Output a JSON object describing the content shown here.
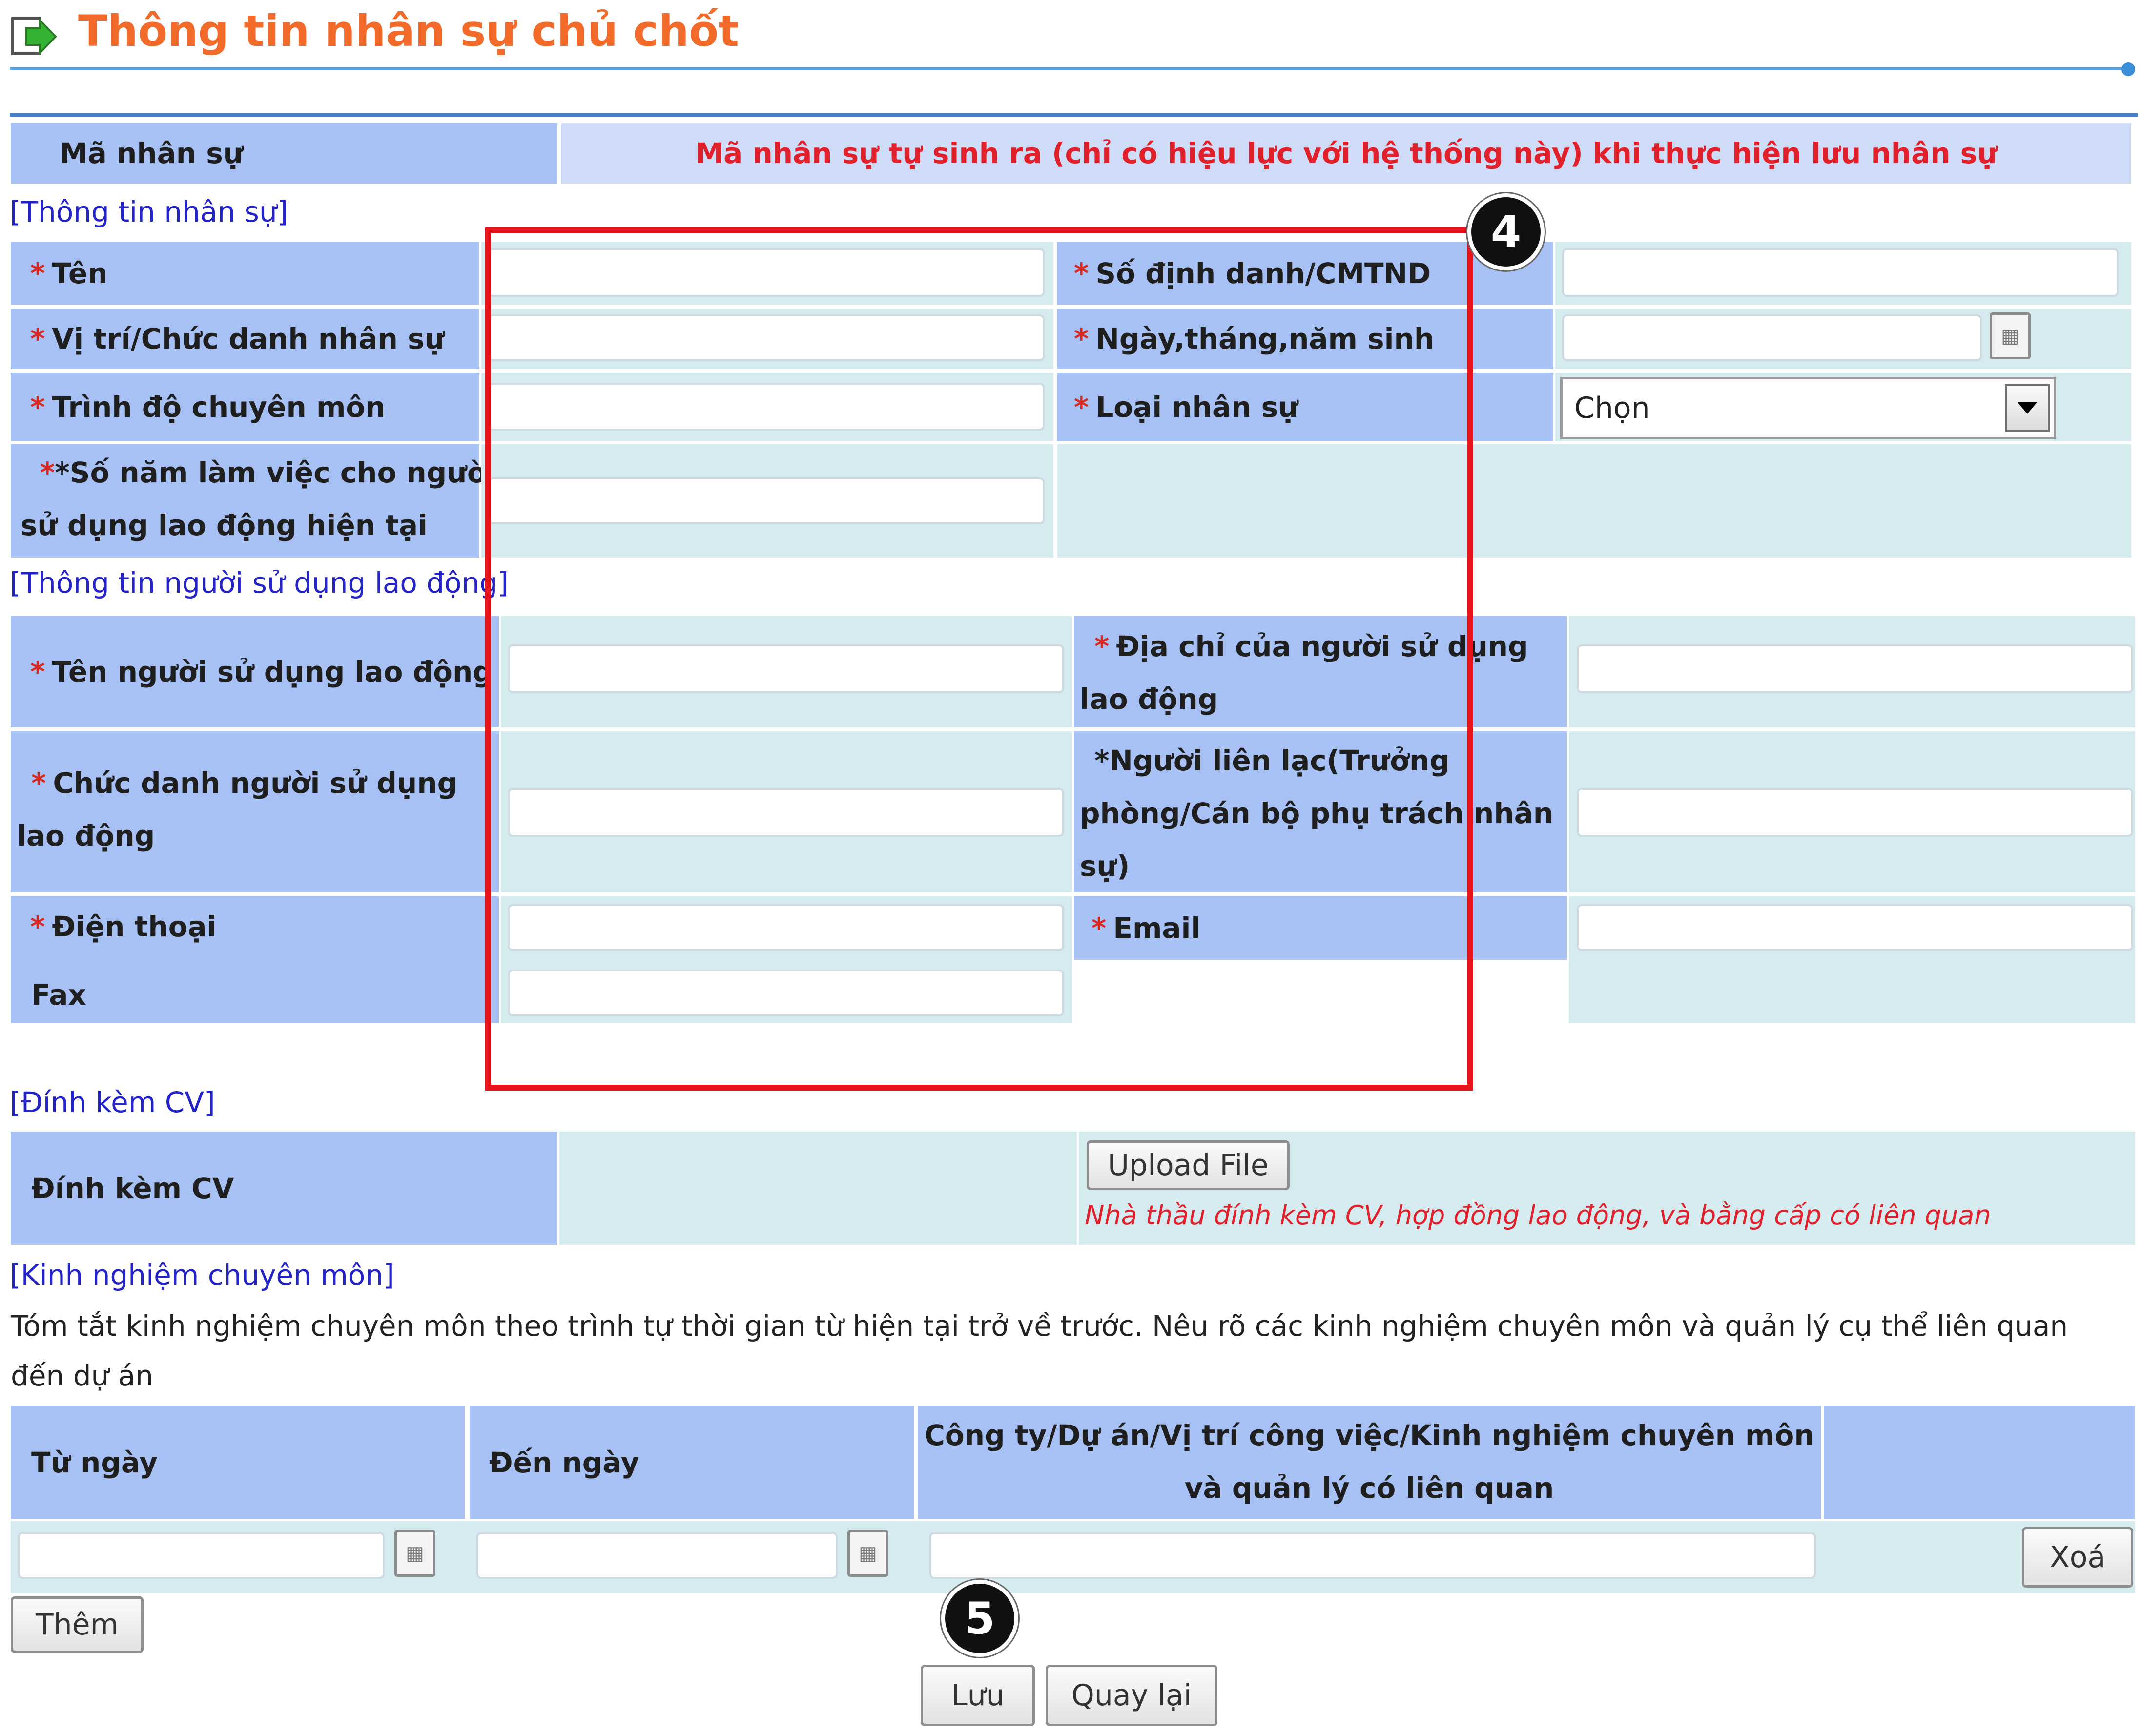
{
  "header": {
    "title": "Thông tin nhân sự chủ chốt"
  },
  "ma_nhan_su": {
    "label": "Mã nhân sự",
    "note": "Mã nhân sự tự sinh ra (chỉ có hiệu lực với hệ thống này) khi thực hiện lưu nhân sự"
  },
  "sections": {
    "personnel": "[Thông tin nhân sự]",
    "employer": "[Thông tin người sử dụng lao động]",
    "cv": "[Đính kèm CV]",
    "experience": "[Kinh nghiệm chuyên môn]"
  },
  "personnel": {
    "ten": "Tên",
    "so_dinh_danh": "Số định danh/CMTND",
    "vi_tri": "Vị trí/Chức danh nhân sự",
    "ngay_sinh": "Ngày,tháng,năm sinh",
    "trinh_do": "Trình độ chuyên môn",
    "loai_nhan_su": "Loại nhân sự",
    "loai_selected": "Chọn",
    "so_nam_line1": "*Số năm làm việc cho người",
    "so_nam_line2": "sử dụng lao động hiện tại"
  },
  "employer": {
    "ten_nsd": "Tên người sử dụng lao động",
    "dia_chi_line1": "Địa chỉ của người sử dụng",
    "dia_chi_line2": "lao động",
    "chuc_danh_line1": "Chức danh người sử dụng",
    "chuc_danh_line2": "lao động",
    "lien_lac_line1": "*Người liên lạc(Trưởng",
    "lien_lac_line2": "phòng/Cán bộ phụ trách nhân",
    "lien_lac_line3": "sự)",
    "dien_thoai": "Điện thoại",
    "email": "Email",
    "fax": "Fax"
  },
  "cv": {
    "label": "Đính kèm CV",
    "upload_button": "Upload File",
    "hint": "Nhà thầu đính kèm CV, hợp đồng lao động, và bằng cấp có liên quan"
  },
  "experience": {
    "desc_line1": "Tóm tắt kinh nghiệm chuyên môn theo trình tự thời gian từ hiện tại trở về trước. Nêu rõ các kinh nghiệm chuyên môn và quản lý cụ thể liên quan",
    "desc_line2": "đến dự án",
    "col_from": "Từ ngày",
    "col_to": "Đến ngày",
    "col_desc_line1": "Công ty/Dự án/Vị trí công việc/Kinh nghiệm chuyên môn",
    "col_desc_line2": "và quản lý có liên quan",
    "delete_button": "Xoá",
    "add_button": "Thêm"
  },
  "actions": {
    "save": "Lưu",
    "back": "Quay lại"
  },
  "annotations": {
    "badge4": "4",
    "badge5": "5"
  },
  "colors": {
    "title": "#f26b2a",
    "label_bg": "#a7c1f5",
    "value_bg": "#d6ebf0",
    "section_link": "#2323c8",
    "required": "#d8281f",
    "highlight_box": "#e8141c"
  }
}
